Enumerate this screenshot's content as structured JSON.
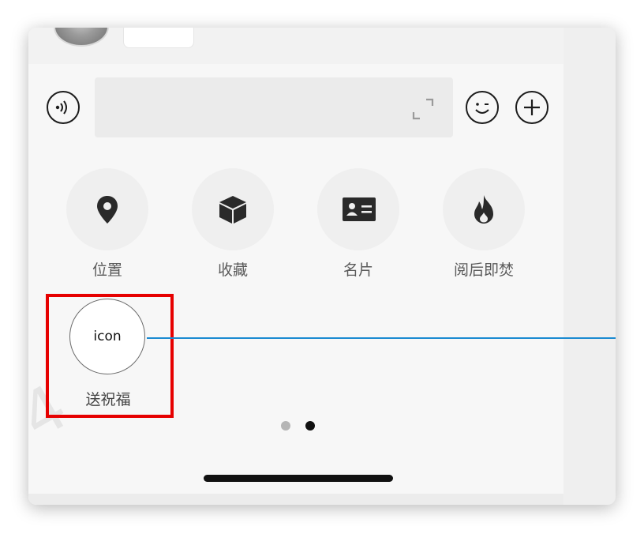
{
  "features": [
    {
      "name": "location",
      "label": "位置",
      "icon": "location-pin-icon"
    },
    {
      "name": "favorites",
      "label": "收藏",
      "icon": "cube-icon"
    },
    {
      "name": "business-card",
      "label": "名片",
      "icon": "id-card-icon"
    },
    {
      "name": "burn-after-reading",
      "label": "阅后即焚",
      "icon": "flame-icon"
    }
  ],
  "send_item": {
    "icon_text": "icon",
    "label": "送祝福"
  },
  "toolbar": {
    "voice_icon": "voice-icon",
    "emoji_icon": "emoji-icon",
    "add_icon": "plus-icon",
    "expand_icon": "expand-icon"
  },
  "pager": {
    "total": 2,
    "active": 2
  },
  "colors": {
    "highlight": "#e60000",
    "guide_line": "#1a8ad1",
    "icon_fill": "#2a2a2a",
    "label": "#5a5a5a"
  }
}
